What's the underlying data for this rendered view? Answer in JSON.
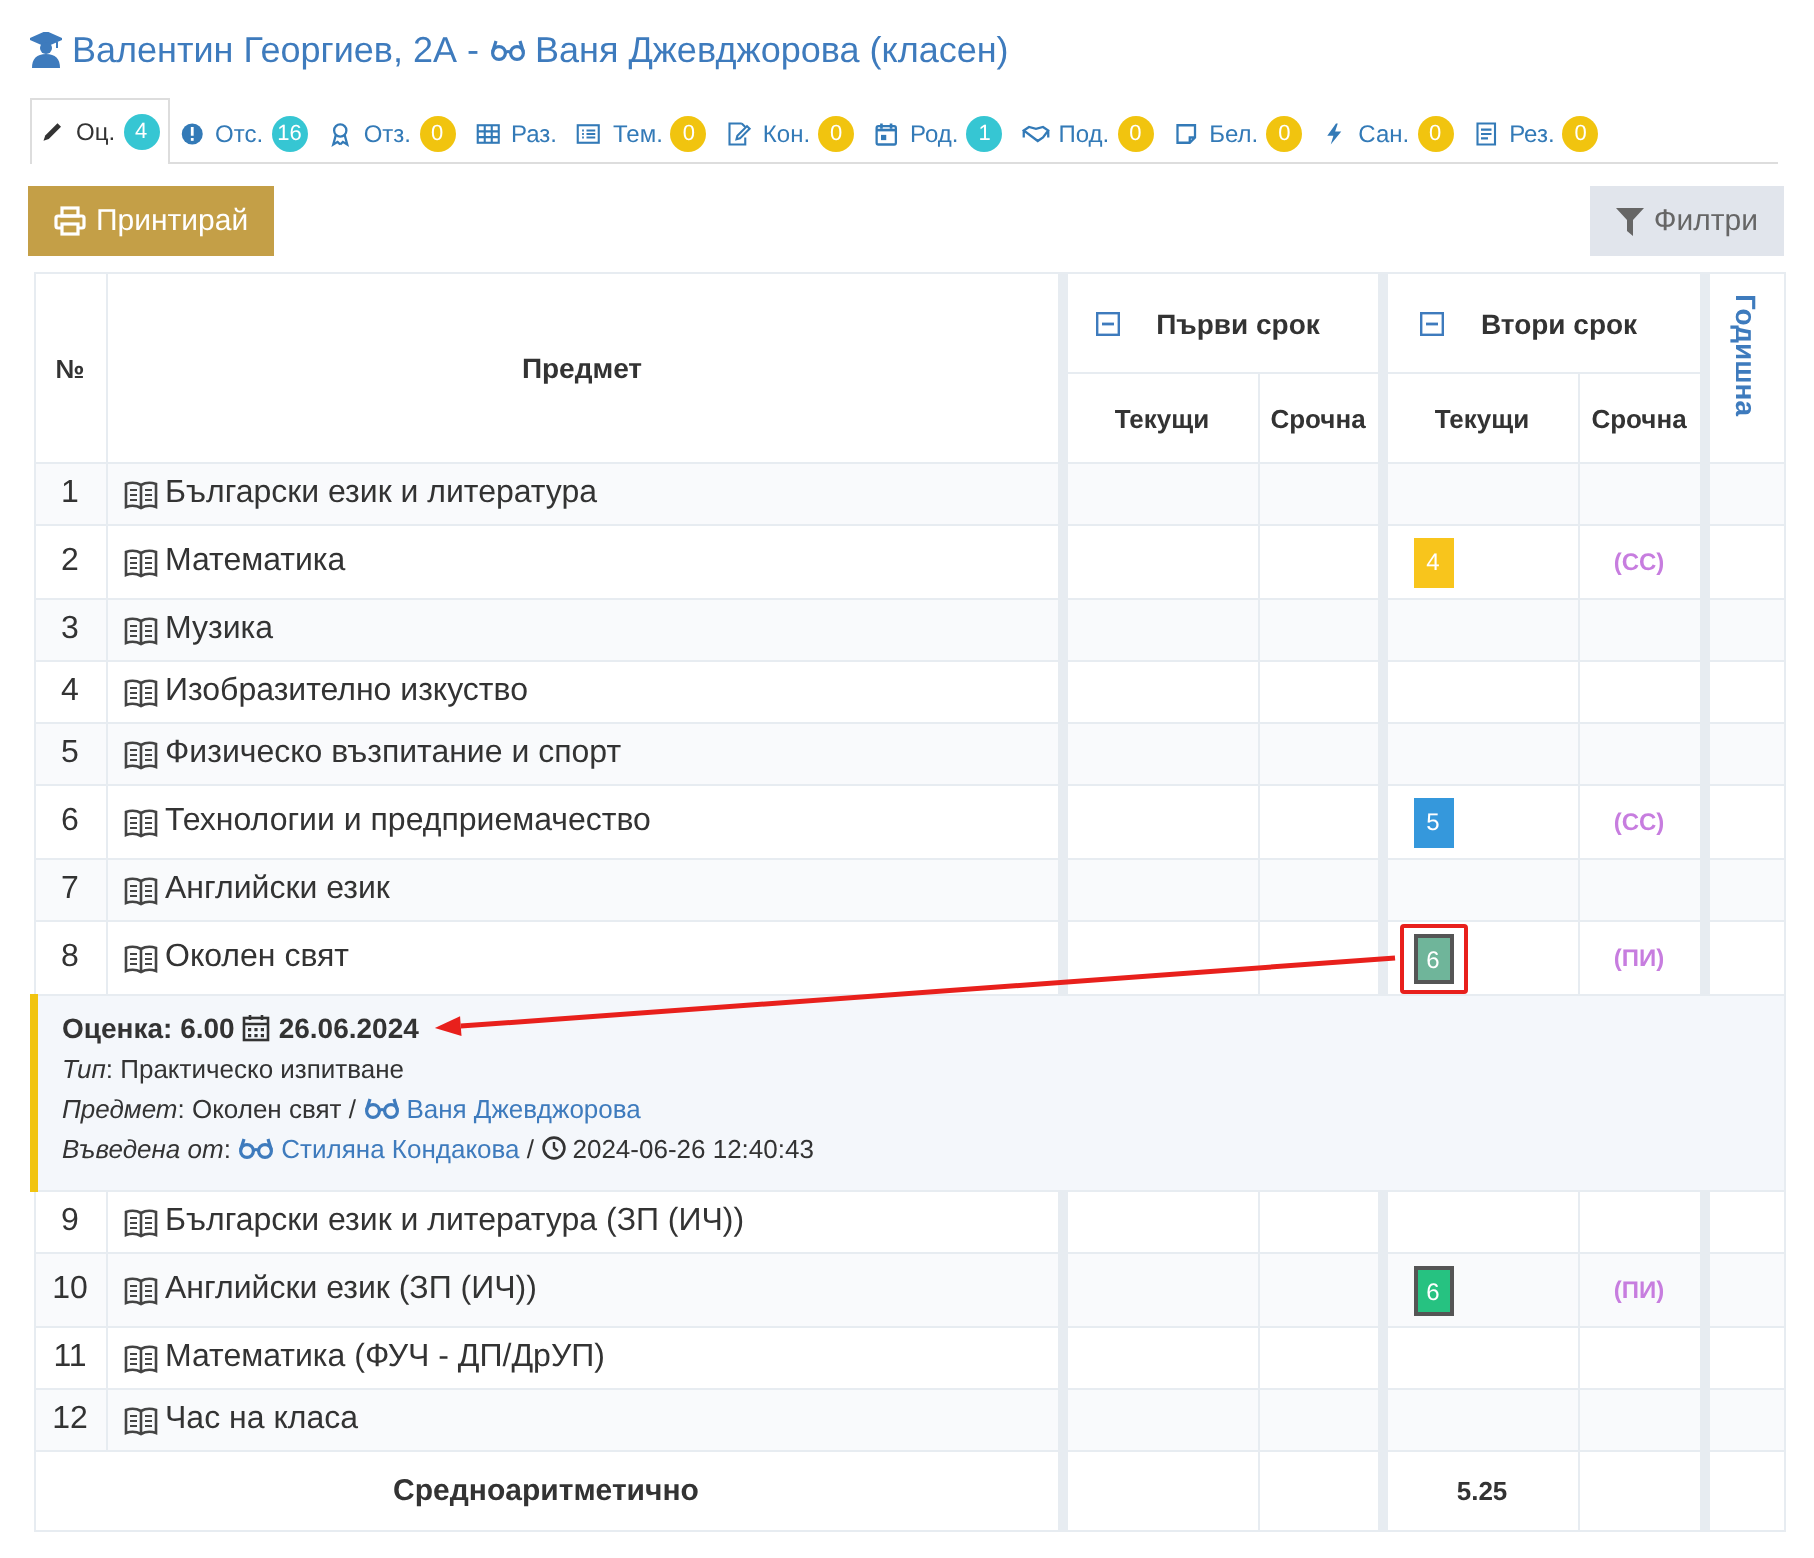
{
  "header": {
    "student": "Валентин Георгиев, 2А -",
    "teacher": "Ваня Джевджорова (класен)"
  },
  "tabs": [
    {
      "label": "Оц.",
      "count": "4",
      "color": "#36c6d3",
      "selected": true
    },
    {
      "label": "Отс.",
      "count": "16",
      "color": "#36c6d3",
      "selected": false
    },
    {
      "label": "Отз.",
      "count": "0",
      "color": "#f1c40f",
      "selected": false
    },
    {
      "label": "Раз.",
      "selected": false
    },
    {
      "label": "Тем.",
      "count": "0",
      "color": "#f1c40f",
      "selected": false
    },
    {
      "label": "Кон.",
      "count": "0",
      "color": "#f1c40f",
      "selected": false
    },
    {
      "label": "Род.",
      "count": "1",
      "color": "#36c6d3",
      "selected": false
    },
    {
      "label": "Под.",
      "count": "0",
      "color": "#f1c40f",
      "selected": false
    },
    {
      "label": "Бел.",
      "count": "0",
      "color": "#f1c40f",
      "selected": false
    },
    {
      "label": "Сан.",
      "count": "0",
      "color": "#f1c40f",
      "selected": false
    },
    {
      "label": "Рез.",
      "count": "0",
      "color": "#f1c40f",
      "selected": false
    }
  ],
  "toolbar": {
    "print_button": "Принтирай",
    "filter_button": "Филтри"
  },
  "table": {
    "columns": {
      "number": "№",
      "subject": "Предмет",
      "annual": "Годишна",
      "terms": [
        {
          "title": "Първи срок",
          "expanded": true,
          "current": "Текущи",
          "final": "Срочна"
        },
        {
          "title": "Втори срок",
          "expanded": true,
          "current": "Текущи",
          "final": "Срочна"
        }
      ]
    },
    "rows": [
      {
        "kind": "subject",
        "number": "1",
        "subject": "Български език и литература"
      },
      {
        "kind": "subject",
        "number": "2",
        "subject": "Математика",
        "second_term": {
          "grade": {
            "value": "4",
            "color": "#f8c51c",
            "bordered": false,
            "highlighted": false
          },
          "final_mark": "(СС)"
        }
      },
      {
        "kind": "subject",
        "number": "3",
        "subject": "Музика"
      },
      {
        "kind": "subject",
        "number": "4",
        "subject": "Изобразително изкуство"
      },
      {
        "kind": "subject",
        "number": "5",
        "subject": "Физическо възпитание и спорт"
      },
      {
        "kind": "subject",
        "number": "6",
        "subject": "Технологии и предприемачество",
        "second_term": {
          "grade": {
            "value": "5",
            "color": "#3598dc",
            "bordered": false,
            "highlighted": false
          },
          "final_mark": "(СС)"
        }
      },
      {
        "kind": "subject",
        "number": "7",
        "subject": "Английски език"
      },
      {
        "kind": "subject",
        "number": "8",
        "subject": "Околен свят",
        "second_term": {
          "grade": {
            "value": "6",
            "color": "#6fb59a",
            "bordered": true,
            "highlighted": true
          },
          "final_mark": "(ПИ)"
        }
      },
      {
        "kind": "detail",
        "title": "Оценка: 6.00",
        "date": "26.06.2024",
        "type_line": "*Тип*: Практическо изпитване",
        "subject_line": "*Предмет*: Околен свят /",
        "subject_teacher": "Ваня Джевджорова",
        "entered_line": "*Въведена от*:",
        "entered_by": "Стиляна Кондакова",
        "entered_sep": "/",
        "entered_at": "2024-06-26 12:40:43"
      },
      {
        "kind": "subject",
        "number": "9",
        "subject": "Български език и литература (ЗП (ИЧ))"
      },
      {
        "kind": "subject",
        "number": "10",
        "subject": "Английски език (ЗП (ИЧ))",
        "second_term": {
          "grade": {
            "value": "6",
            "color": "#26c281",
            "bordered": true,
            "highlighted": false
          },
          "final_mark": "(ПИ)"
        }
      },
      {
        "kind": "subject",
        "number": "11",
        "subject": "Математика (ФУЧ - ДП/ДрУП)"
      },
      {
        "kind": "subject",
        "number": "12",
        "subject": "Час на класа"
      }
    ],
    "average": {
      "label": "Средноаритметично",
      "second_term_current": "5.25"
    }
  }
}
